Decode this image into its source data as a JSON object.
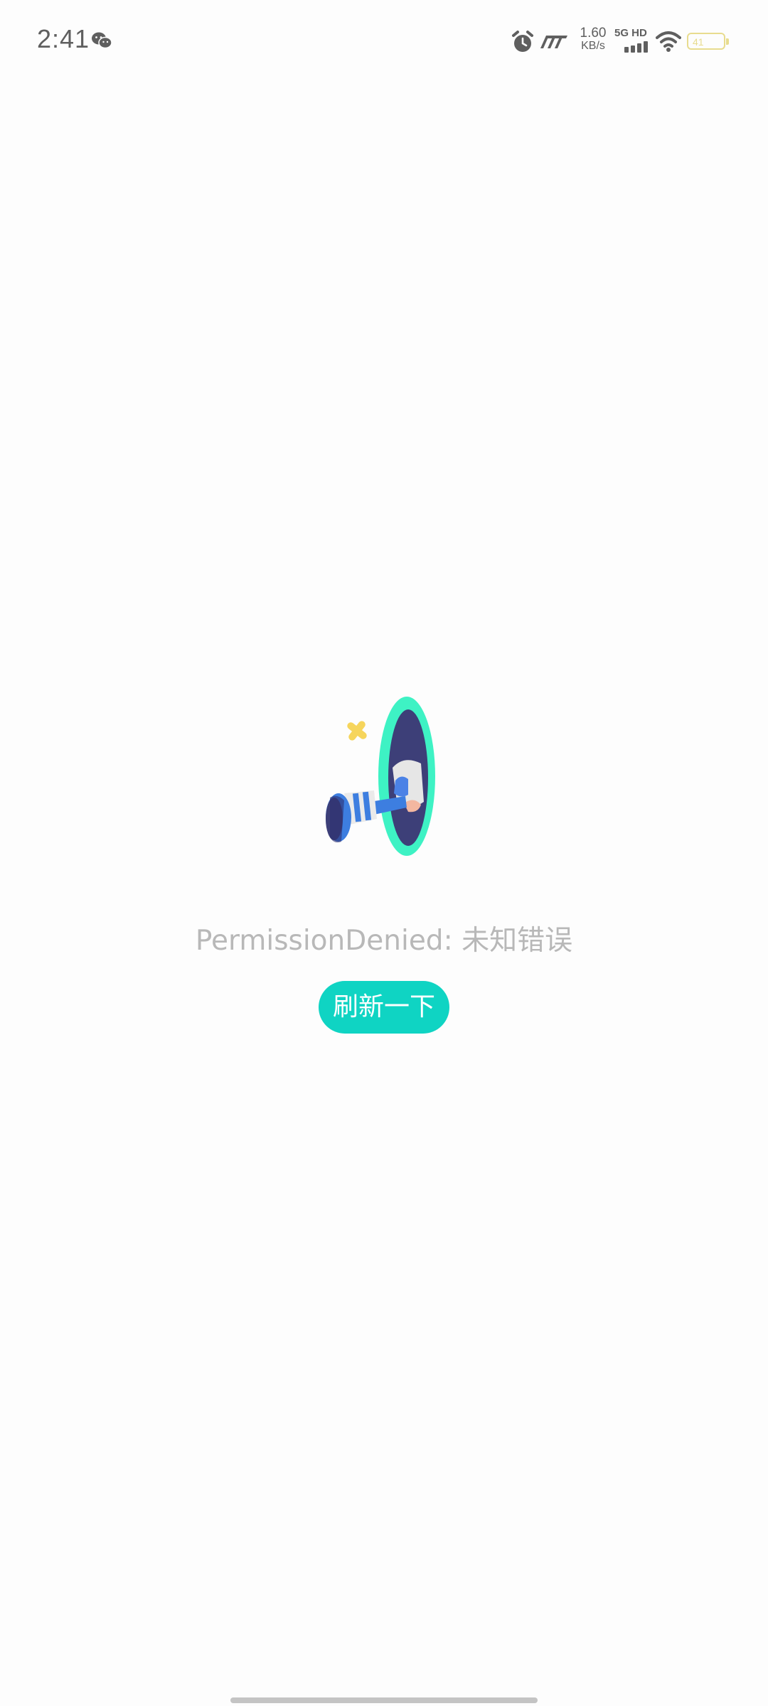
{
  "status_bar": {
    "time": "2:41",
    "net_speed_value": "1.60",
    "net_speed_unit": "KB/s",
    "signal_label": "5G HD",
    "battery_level": "41",
    "icons": [
      "wechat-icon",
      "alarm-icon",
      "moto-icon",
      "signal-icon",
      "wifi-icon",
      "battery-icon"
    ]
  },
  "content": {
    "illustration": "portal-illustration",
    "error_message": "PermissionDenied: 未知错误",
    "refresh_label": "刷新一下"
  },
  "colors": {
    "accent": "#0fd4c3",
    "portal_ring": "#3ef2c4",
    "portal_inner": "#3d3f78",
    "sparkle": "#f6d55c",
    "shoe_blue": "#3d7ee0",
    "message_gray": "#b8b8b8",
    "battery": "#e8dc8f"
  }
}
